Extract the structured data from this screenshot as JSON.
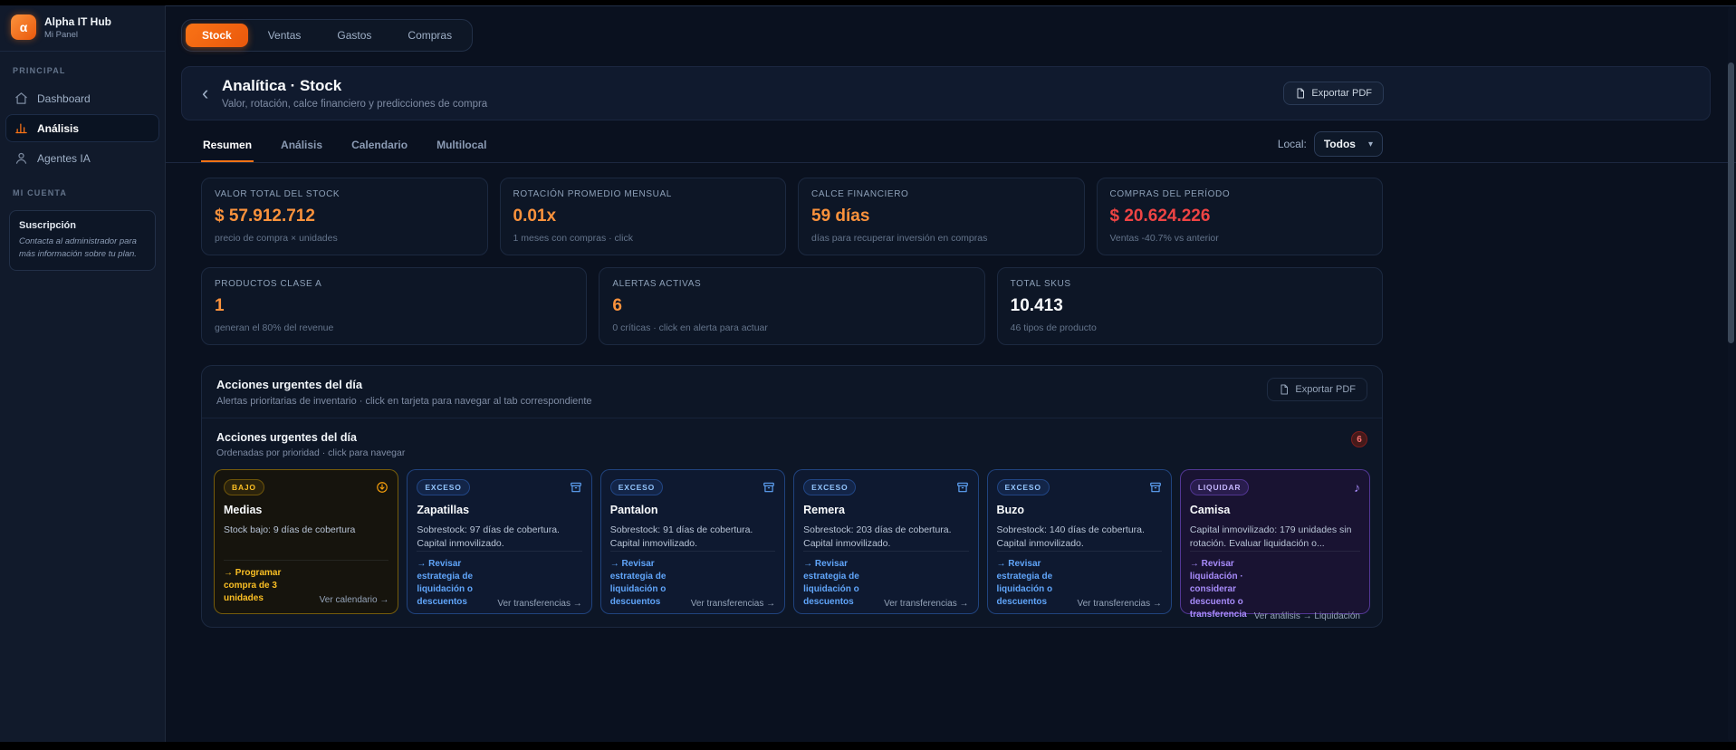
{
  "colors": {
    "accent_orange": "#f97316",
    "value_orange": "#fb923c",
    "value_red": "#ef4444",
    "info_blue": "#60a5fa",
    "warn_yellow": "#fbbf24",
    "purple": "#a78bfa",
    "sidebar_bg": "#111a2b",
    "main_bg": "#0a111f",
    "card_bg": "#0d1626"
  },
  "sidebar": {
    "logo_glyph": "α",
    "app_name": "Alpha IT Hub",
    "app_subtitle": "Mi Panel",
    "section_principal": "PRINCIPAL",
    "items": [
      {
        "label": "Dashboard"
      },
      {
        "label": "Análisis"
      },
      {
        "label": "Agentes IA"
      }
    ],
    "section_account": "MI CUENTA",
    "subscription": {
      "title": "Suscripción",
      "text": "Contacta al administrador para más información sobre tu plan."
    }
  },
  "top_tabs": [
    "Stock",
    "Ventas",
    "Gastos",
    "Compras"
  ],
  "header": {
    "back": "‹",
    "title": "Analítica · Stock",
    "subtitle": "Valor, rotación, calce financiero y predicciones de compra",
    "export_label": "Exportar PDF"
  },
  "sub_tabs": [
    "Resumen",
    "Análisis",
    "Calendario",
    "Multilocal"
  ],
  "local_filter": {
    "label": "Local:",
    "value": "Todos",
    "chevron": "▾"
  },
  "kpis_row1": [
    {
      "label": "VALOR TOTAL DEL STOCK",
      "value": "$ 57.912.712",
      "sub": "precio de compra × unidades",
      "color": "#fb923c"
    },
    {
      "label": "ROTACIÓN PROMEDIO MENSUAL",
      "value": "0.01x",
      "sub": "1 meses con compras · click",
      "color": "#fb923c"
    },
    {
      "label": "CALCE FINANCIERO",
      "value": "59 días",
      "sub": "días para recuperar inversión en compras",
      "color": "#fb923c"
    },
    {
      "label": "COMPRAS DEL PERÍODO",
      "value": "$ 20.624.226",
      "sub": "Ventas -40.7% vs anterior",
      "color": "#ef4444"
    }
  ],
  "kpis_row2": [
    {
      "label": "PRODUCTOS CLASE A",
      "value": "1",
      "sub": "generan el 80% del revenue",
      "color": "#fb923c"
    },
    {
      "label": "ALERTAS ACTIVAS",
      "value": "6",
      "sub": "0 críticas · click en alerta para actuar",
      "color": "#fb923c"
    },
    {
      "label": "TOTAL SKUS",
      "value": "10.413",
      "sub": "46 tipos de producto",
      "color": "#f8fafc"
    }
  ],
  "actions": {
    "panel_title": "Acciones urgentes del día",
    "panel_subtitle": "Alertas prioritarias de inventario · click en tarjeta para navegar al tab correspondiente",
    "export_label": "Exportar PDF",
    "inner_title": "Acciones urgentes del día",
    "inner_subtitle": "Ordenadas por prioridad · click para navegar",
    "count": "6",
    "cards": [
      {
        "badge": "BAJO",
        "title": "Medias",
        "body": "Stock bajo: 9 días de cobertura",
        "action": "→ Programar compra de 3 unidades",
        "link": "Ver calendario →"
      },
      {
        "badge": "EXCESO",
        "title": "Zapatillas",
        "body": "Sobrestock: 97 días de cobertura. Capital inmovilizado.",
        "action": "→ Revisar estrategia de liquidación o descuentos",
        "link": "Ver transferencias →"
      },
      {
        "badge": "EXCESO",
        "title": "Pantalon",
        "body": "Sobrestock: 91 días de cobertura. Capital inmovilizado.",
        "action": "→ Revisar estrategia de liquidación o descuentos",
        "link": "Ver transferencias →"
      },
      {
        "badge": "EXCESO",
        "title": "Remera",
        "body": "Sobrestock: 203 días de cobertura. Capital inmovilizado.",
        "action": "→ Revisar estrategia de liquidación o descuentos",
        "link": "Ver transferencias →"
      },
      {
        "badge": "EXCESO",
        "title": "Buzo",
        "body": "Sobrestock: 140 días de cobertura. Capital inmovilizado.",
        "action": "→ Revisar estrategia de liquidación o descuentos",
        "link": "Ver transferencias →"
      },
      {
        "badge": "LIQUIDAR",
        "title": "Camisa",
        "body": "Capital inmovilizado: 179 unidades sin rotación. Evaluar liquidación o...",
        "action": "→ Revisar liquidación · considerar descuento o transferencia",
        "link": "Ver análisis → Liquidación"
      }
    ]
  }
}
